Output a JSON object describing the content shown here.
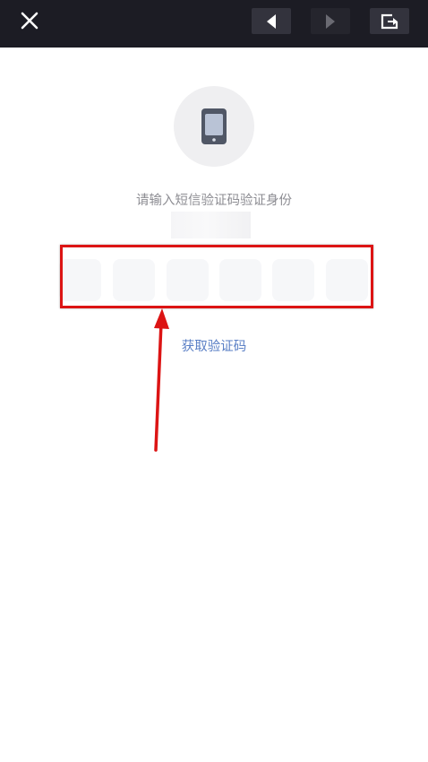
{
  "topbar": {
    "close_icon": "close-icon",
    "back_icon": "back-arrow-icon",
    "forward_icon": "forward-arrow-icon",
    "share_icon": "share-icon"
  },
  "verify": {
    "phone_icon": "phone-icon",
    "prompt": "请输入短信验证码验证身份",
    "code_digits": [
      "",
      "",
      "",
      "",
      "",
      ""
    ],
    "get_code_link": "获取验证码"
  },
  "annotation": {
    "highlight_color": "#dc1414",
    "arrow_color": "#dc1414"
  },
  "colors": {
    "topbar_bg": "#1c1c24",
    "link": "#5a7fc5",
    "prompt_text": "#8d8d93"
  }
}
